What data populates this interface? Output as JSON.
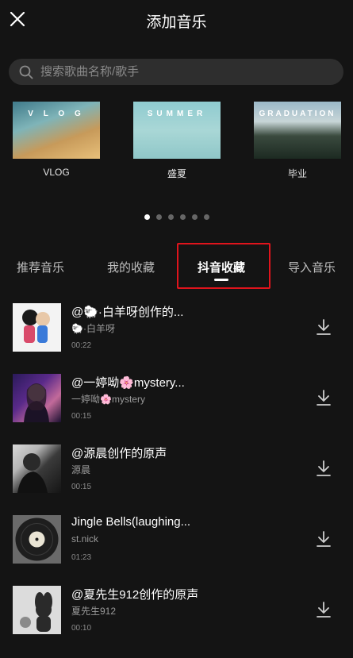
{
  "header": {
    "title": "添加音乐"
  },
  "search": {
    "placeholder": "搜索歌曲名称/歌手"
  },
  "categories": [
    {
      "label": "VLOG",
      "art_text": "V L O G"
    },
    {
      "label": "盛夏",
      "art_text": "SUMMER"
    },
    {
      "label": "毕业",
      "art_text": "GRADUATION"
    }
  ],
  "pagination": {
    "count": 6,
    "active_index": 0
  },
  "tabs": [
    {
      "label": "推荐音乐"
    },
    {
      "label": "我的收藏"
    },
    {
      "label": "抖音收藏",
      "active": true
    },
    {
      "label": "导入音乐"
    }
  ],
  "songs": [
    {
      "title": "@🐑·白羊呀创作的...",
      "artist": "🐑·白羊呀",
      "duration": "00:22"
    },
    {
      "title": "@一婷呦🌸mystery...",
      "artist": "一婷呦🌸mystery",
      "duration": "00:15"
    },
    {
      "title": "@源晨创作的原声",
      "artist": "源晨",
      "duration": "00:15"
    },
    {
      "title": "Jingle Bells(laughing...",
      "artist": "st.nick",
      "duration": "01:23"
    },
    {
      "title": "@夏先生912创作的原声",
      "artist": "夏先生912",
      "duration": "00:10"
    }
  ],
  "colors": {
    "background": "#141414",
    "highlight_box": "#e0141c",
    "search_bg": "#2e2e2e"
  }
}
